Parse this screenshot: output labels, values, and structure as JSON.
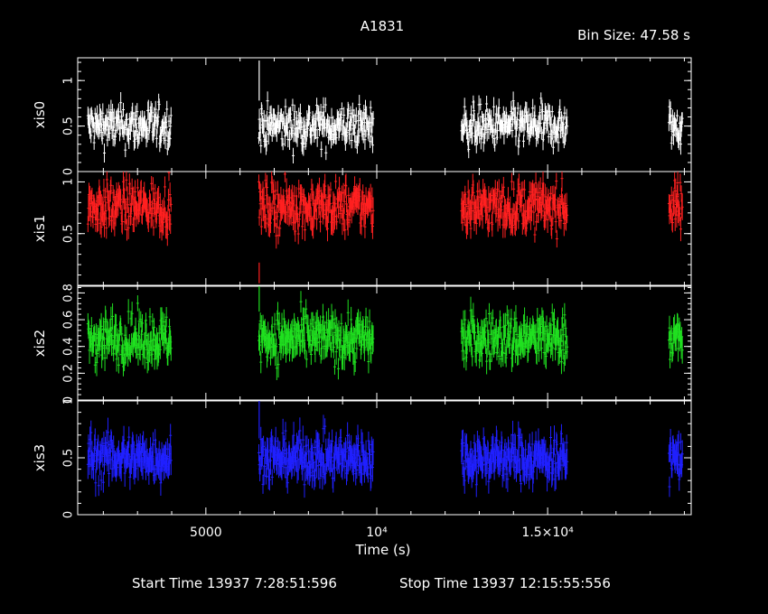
{
  "title": "A1831",
  "bin_size_label": "Bin Size:  47.58  s",
  "footer": {
    "start_label": "Start Time 13937  7:28:51:596",
    "stop_label": "Stop Time 13937 12:15:55:556"
  },
  "chart_data": {
    "type": "scatter",
    "title": "A1831",
    "xlabel": "Time (s)",
    "xlim": [
      1250,
      19200
    ],
    "x_ticks": [
      {
        "value": 5000,
        "label": "5000"
      },
      {
        "value": 10000,
        "label": "10⁴"
      },
      {
        "value": 15000,
        "label": "1.5×10⁴"
      }
    ],
    "good_time_intervals": [
      [
        1550,
        3990
      ],
      [
        6550,
        9900
      ],
      [
        12480,
        15580
      ],
      [
        18550,
        18940
      ]
    ],
    "bin_size_s": 47.58,
    "panels": [
      {
        "name": "xis0",
        "ylabel": "xis0",
        "color": "#ffffff",
        "ylim": [
          0,
          1.25
        ],
        "y_ticks": [
          {
            "value": 0,
            "label": "0"
          },
          {
            "value": 0.5,
            "label": "0.5"
          },
          {
            "value": 1,
            "label": "1"
          }
        ],
        "mean": 0.5,
        "spread": 0.15,
        "err": 0.09,
        "outliers": [
          {
            "x": 6560,
            "y": 1.0,
            "err": 0.22
          }
        ]
      },
      {
        "name": "xis1",
        "ylabel": "xis1",
        "color": "#ff2020",
        "ylim": [
          0,
          1.1
        ],
        "y_ticks": [
          {
            "value": 0.5,
            "label": "0.5"
          },
          {
            "value": 1,
            "label": "1"
          }
        ],
        "mean": 0.76,
        "spread": 0.15,
        "err": 0.1,
        "outliers": [
          {
            "x": 6560,
            "y": 0.12,
            "err": 0.1
          }
        ]
      },
      {
        "name": "xis2",
        "ylabel": "xis2",
        "color": "#20e020",
        "ylim": [
          0,
          0.85
        ],
        "y_ticks": [
          {
            "value": 0,
            "label": "0"
          },
          {
            "value": 0.2,
            "label": "0.2"
          },
          {
            "value": 0.4,
            "label": "0.4"
          },
          {
            "value": 0.6,
            "label": "0.6"
          },
          {
            "value": 0.8,
            "label": "0.8"
          }
        ],
        "mean": 0.46,
        "spread": 0.12,
        "err": 0.08,
        "outliers": [
          {
            "x": 6560,
            "y": 0.78,
            "err": 0.12
          }
        ]
      },
      {
        "name": "xis3",
        "ylabel": "xis3",
        "color": "#2020ff",
        "ylim": [
          0,
          1.0
        ],
        "y_ticks": [
          {
            "value": 0,
            "label": "0"
          },
          {
            "value": 0.5,
            "label": "0.5"
          },
          {
            "value": 1,
            "label": "1"
          }
        ],
        "mean": 0.5,
        "spread": 0.13,
        "err": 0.1,
        "outliers": [
          {
            "x": 6560,
            "y": 0.85,
            "err": 0.18
          }
        ]
      }
    ]
  }
}
